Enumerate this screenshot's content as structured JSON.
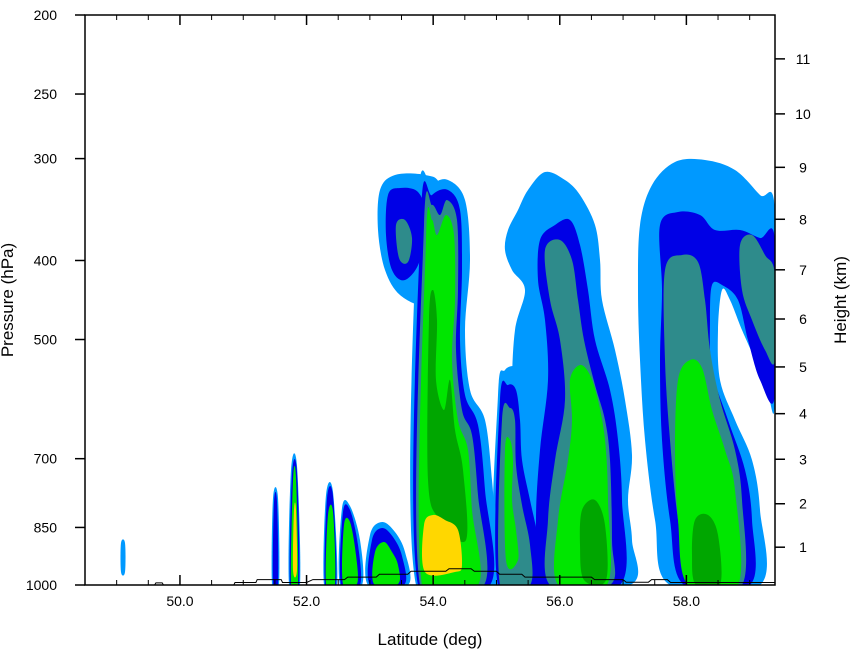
{
  "chart_data": {
    "type": "contour",
    "xlabel": "Latitude (deg)",
    "ylabel_left": "Pressure (hPa)",
    "ylabel_right": "Height (km)",
    "xlim": [
      48.5,
      59.4
    ],
    "pressure_range": [
      1000,
      200
    ],
    "pressure_scale": "log",
    "x_ticks": [
      50.0,
      52.0,
      54.0,
      56.0,
      58.0
    ],
    "x_tick_labels": [
      "50.0",
      "52.0",
      "54.0",
      "56.0",
      "58.0"
    ],
    "pressure_ticks": [
      200,
      250,
      300,
      400,
      500,
      700,
      850,
      1000
    ],
    "pressure_tick_labels": [
      "200",
      "250",
      "300",
      "400",
      "500",
      "700",
      "850",
      "1000"
    ],
    "height_ticks": [
      1,
      2,
      3,
      4,
      5,
      6,
      7,
      8,
      9,
      10,
      11
    ],
    "height_tick_labels": [
      "1",
      "2",
      "3",
      "4",
      "5",
      "6",
      "7",
      "8",
      "9",
      "10",
      "11"
    ],
    "legend": "none",
    "colors": {
      "level1": "#0099ff",
      "level2": "#0000e6",
      "level3": "#2e8b8b",
      "level4": "#00e600",
      "level5": "#00a600",
      "level6": "#ffd700",
      "terrain": "#000000"
    },
    "cells": [
      {
        "name": "cell-49.2",
        "lat_range": [
          49.15,
          49.25
        ],
        "p_range": [
          960,
          880
        ],
        "peak_level": 1
      },
      {
        "name": "cell-51.6",
        "lat_range": [
          51.5,
          51.65
        ],
        "p_range": [
          1000,
          800
        ],
        "peak_level": 2
      },
      {
        "name": "cell-51.9",
        "lat_range": [
          51.8,
          51.95
        ],
        "p_range": [
          1000,
          740
        ],
        "peak_level": 6
      },
      {
        "name": "cell-52.4",
        "lat_range": [
          52.3,
          52.55
        ],
        "p_range": [
          1000,
          790
        ],
        "peak_level": 4
      },
      {
        "name": "cell-52.7",
        "lat_range": [
          52.55,
          52.95
        ],
        "p_range": [
          1000,
          820
        ],
        "peak_level": 4
      },
      {
        "name": "cell-53.2",
        "lat_range": [
          53.0,
          53.4
        ],
        "p_range": [
          1000,
          860
        ],
        "peak_level": 4
      },
      {
        "name": "cell-53.8",
        "lat_range": [
          53.6,
          54.2
        ],
        "p_range": [
          1000,
          300
        ],
        "peak_level": 6
      },
      {
        "name": "cell-54.5",
        "lat_range": [
          54.1,
          55.0
        ],
        "p_range": [
          1000,
          320
        ],
        "peak_level": 6
      },
      {
        "name": "cell-55.3",
        "lat_range": [
          55.0,
          55.9
        ],
        "p_range": [
          1000,
          560
        ],
        "peak_level": 4
      },
      {
        "name": "cell-56.2",
        "lat_range": [
          55.5,
          57.4
        ],
        "p_range": [
          1000,
          310
        ],
        "peak_level": 5
      },
      {
        "name": "cell-58.4",
        "lat_range": [
          57.4,
          59.4
        ],
        "p_range": [
          1000,
          305
        ],
        "peak_level": 5
      }
    ]
  }
}
